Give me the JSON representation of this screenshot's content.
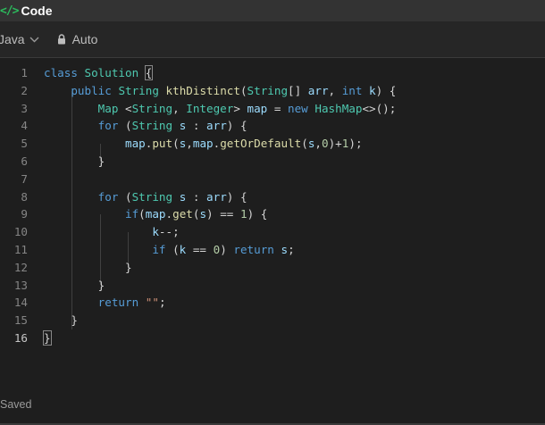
{
  "window": {
    "title": "Code",
    "icon": "code-brackets-icon"
  },
  "toolbar": {
    "language": "Java",
    "mode": "Auto"
  },
  "editor": {
    "active_line": 16,
    "lines": [
      {
        "n": "1",
        "tokens": [
          [
            "kw",
            "class"
          ],
          [
            "pl",
            " "
          ],
          [
            "ty",
            "Solution"
          ],
          [
            "pl",
            " "
          ],
          [
            "hl",
            "{"
          ]
        ]
      },
      {
        "n": "2",
        "tokens": [
          [
            "pl",
            "    "
          ],
          [
            "kw",
            "public"
          ],
          [
            "pl",
            " "
          ],
          [
            "ty",
            "String"
          ],
          [
            "pl",
            " "
          ],
          [
            "fn",
            "kthDistinct"
          ],
          [
            "pl",
            "("
          ],
          [
            "ty",
            "String"
          ],
          [
            "pl",
            "[] "
          ],
          [
            "va",
            "arr"
          ],
          [
            "pl",
            ", "
          ],
          [
            "kw",
            "int"
          ],
          [
            "pl",
            " "
          ],
          [
            "va",
            "k"
          ],
          [
            "pl",
            ") {"
          ]
        ]
      },
      {
        "n": "3",
        "tokens": [
          [
            "pl",
            "        "
          ],
          [
            "ty",
            "Map"
          ],
          [
            "pl",
            " <"
          ],
          [
            "ty",
            "String"
          ],
          [
            "pl",
            ", "
          ],
          [
            "ty",
            "Integer"
          ],
          [
            "pl",
            "> "
          ],
          [
            "va",
            "map"
          ],
          [
            "pl",
            " = "
          ],
          [
            "kw",
            "new"
          ],
          [
            "pl",
            " "
          ],
          [
            "ty",
            "HashMap"
          ],
          [
            "pl",
            "<>();"
          ]
        ]
      },
      {
        "n": "4",
        "tokens": [
          [
            "pl",
            "        "
          ],
          [
            "kw",
            "for"
          ],
          [
            "pl",
            " ("
          ],
          [
            "ty",
            "String"
          ],
          [
            "pl",
            " "
          ],
          [
            "va",
            "s"
          ],
          [
            "pl",
            " : "
          ],
          [
            "va",
            "arr"
          ],
          [
            "pl",
            ") {"
          ]
        ]
      },
      {
        "n": "5",
        "tokens": [
          [
            "pl",
            "            "
          ],
          [
            "va",
            "map"
          ],
          [
            "pl",
            "."
          ],
          [
            "fn",
            "put"
          ],
          [
            "pl",
            "("
          ],
          [
            "va",
            "s"
          ],
          [
            "pl",
            ","
          ],
          [
            "va",
            "map"
          ],
          [
            "pl",
            "."
          ],
          [
            "fn",
            "getOrDefault"
          ],
          [
            "pl",
            "("
          ],
          [
            "va",
            "s"
          ],
          [
            "pl",
            ","
          ],
          [
            "nu",
            "0"
          ],
          [
            "pl",
            ")+"
          ],
          [
            "nu",
            "1"
          ],
          [
            "pl",
            ");"
          ]
        ]
      },
      {
        "n": "6",
        "tokens": [
          [
            "pl",
            "        }"
          ]
        ]
      },
      {
        "n": "7",
        "tokens": []
      },
      {
        "n": "8",
        "tokens": [
          [
            "pl",
            "        "
          ],
          [
            "kw",
            "for"
          ],
          [
            "pl",
            " ("
          ],
          [
            "ty",
            "String"
          ],
          [
            "pl",
            " "
          ],
          [
            "va",
            "s"
          ],
          [
            "pl",
            " : "
          ],
          [
            "va",
            "arr"
          ],
          [
            "pl",
            ") {"
          ]
        ]
      },
      {
        "n": "9",
        "tokens": [
          [
            "pl",
            "            "
          ],
          [
            "kw",
            "if"
          ],
          [
            "pl",
            "("
          ],
          [
            "va",
            "map"
          ],
          [
            "pl",
            "."
          ],
          [
            "fn",
            "get"
          ],
          [
            "pl",
            "("
          ],
          [
            "va",
            "s"
          ],
          [
            "pl",
            ") == "
          ],
          [
            "nu",
            "1"
          ],
          [
            "pl",
            ") {"
          ]
        ]
      },
      {
        "n": "10",
        "tokens": [
          [
            "pl",
            "                "
          ],
          [
            "va",
            "k"
          ],
          [
            "pl",
            "--;"
          ]
        ]
      },
      {
        "n": "11",
        "tokens": [
          [
            "pl",
            "                "
          ],
          [
            "kw",
            "if"
          ],
          [
            "pl",
            " ("
          ],
          [
            "va",
            "k"
          ],
          [
            "pl",
            " == "
          ],
          [
            "nu",
            "0"
          ],
          [
            "pl",
            ") "
          ],
          [
            "kw",
            "return"
          ],
          [
            "pl",
            " "
          ],
          [
            "va",
            "s"
          ],
          [
            "pl",
            ";"
          ]
        ]
      },
      {
        "n": "12",
        "tokens": [
          [
            "pl",
            "            }"
          ]
        ]
      },
      {
        "n": "13",
        "tokens": [
          [
            "pl",
            "        }"
          ]
        ]
      },
      {
        "n": "14",
        "tokens": [
          [
            "pl",
            "        "
          ],
          [
            "kw",
            "return"
          ],
          [
            "pl",
            " "
          ],
          [
            "st",
            "\"\""
          ],
          [
            "pl",
            ";"
          ]
        ]
      },
      {
        "n": "15",
        "tokens": [
          [
            "pl",
            "    }"
          ]
        ]
      },
      {
        "n": "16",
        "tokens": [
          [
            "hl",
            "}"
          ]
        ]
      }
    ]
  },
  "status": {
    "saved_label": "Saved"
  }
}
